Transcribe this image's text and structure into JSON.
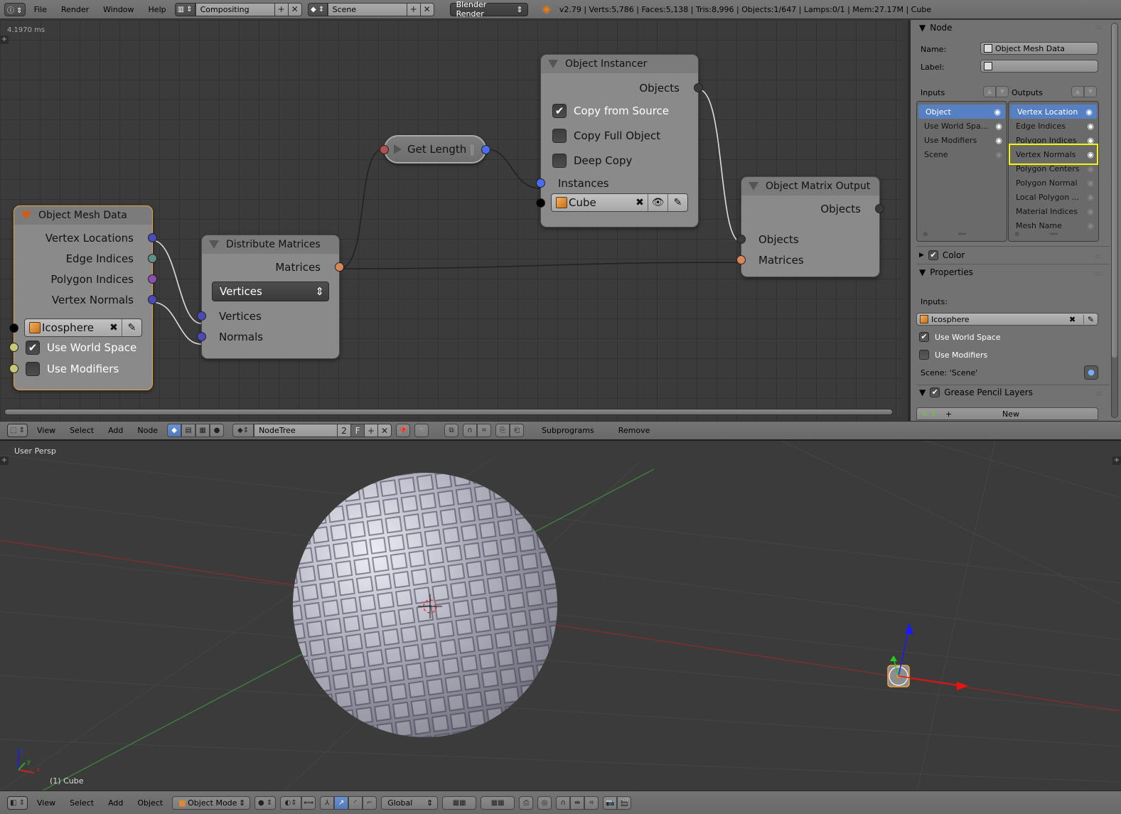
{
  "topbar": {
    "info_icon": "info-icon",
    "menus": [
      "File",
      "Render",
      "Window",
      "Help"
    ],
    "screen_layout": "Compositing",
    "scene": "Scene",
    "render_engine": "Blender Render",
    "stats": "v2.79 | Verts:5,786 | Faces:5,138 | Tris:8,996 | Objects:1/647 | Lamps:0/1 | Mem:27.17M | Cube"
  },
  "node_editor": {
    "timing": "4.1970 ms",
    "nodes": {
      "object_mesh_data": {
        "title": "Object Mesh Data",
        "outputs": [
          "Vertex Locations",
          "Edge Indices",
          "Polygon Indices",
          "Vertex Normals"
        ],
        "object": "Icosphere",
        "use_world_space": {
          "label": "Use World Space",
          "checked": true
        },
        "use_modifiers": {
          "label": "Use Modifiers",
          "checked": false
        }
      },
      "distribute_matrices": {
        "title": "Distribute Matrices",
        "output": "Matrices",
        "mode": "Vertices",
        "inputs": [
          "Vertices",
          "Normals"
        ]
      },
      "get_length": {
        "title": "Get Length"
      },
      "object_instancer": {
        "title": "Object Instancer",
        "output": "Objects",
        "copy_from_source": {
          "label": "Copy from Source",
          "checked": true
        },
        "copy_full_object": {
          "label": "Copy Full Object",
          "checked": false
        },
        "deep_copy": {
          "label": "Deep Copy",
          "checked": false
        },
        "input": "Instances",
        "object": "Cube"
      },
      "object_matrix_output": {
        "title": "Object Matrix Output",
        "output": "Objects",
        "inputs": [
          "Objects",
          "Matrices"
        ]
      }
    },
    "socket_colors": {
      "vector": "#4a4ab8",
      "edge_indices": "#5f8f86",
      "polygon_indices": "#8a50b0",
      "matrix": "#d9875a",
      "object": "#3a3a3a",
      "boolean": "#c8c878",
      "integer": "#4a6cf0",
      "list_input": "#b05050"
    }
  },
  "properties": {
    "node_panel_title": "Node",
    "name_label": "Name:",
    "name_value": "Object Mesh Data",
    "label_label": "Label:",
    "label_value": "",
    "inputs_title": "Inputs",
    "outputs_title": "Outputs",
    "inputs": [
      {
        "label": "Object",
        "visible": true,
        "selected": true
      },
      {
        "label": "Use World Spa...",
        "visible": true
      },
      {
        "label": "Use Modifiers",
        "visible": true
      },
      {
        "label": "Scene",
        "visible": false
      }
    ],
    "outputs": [
      {
        "label": "Vertex Location",
        "visible": true,
        "selected": true
      },
      {
        "label": "Edge Indices",
        "visible": true
      },
      {
        "label": "Polygon Indices",
        "visible": true
      },
      {
        "label": "Vertex Normals",
        "visible": true,
        "highlighted": true
      },
      {
        "label": "Polygon Centers",
        "visible": false
      },
      {
        "label": "Polygon Normal",
        "visible": false
      },
      {
        "label": "Local Polygon ...",
        "visible": false
      },
      {
        "label": "Material Indices",
        "visible": false
      },
      {
        "label": "Mesh Name",
        "visible": false
      }
    ],
    "color_panel": "Color",
    "properties_panel": "Properties",
    "inputs_sub": "Inputs:",
    "object": "Icosphere",
    "use_world_space": "Use World Space",
    "use_modifiers": "Use Modifiers",
    "scene": "Scene: 'Scene'",
    "grease_pencil": "Grease Pencil Layers",
    "new_button": "New"
  },
  "node_header": {
    "menus": [
      "View",
      "Select",
      "Add",
      "Node"
    ],
    "tree_name": "NodeTree",
    "users": "2",
    "fake_user": "F",
    "extra": [
      "Subprograms",
      "Remove"
    ]
  },
  "viewport": {
    "view_label": "User Persp",
    "object_label": "(1) Cube"
  },
  "viewport_header": {
    "menus": [
      "View",
      "Select",
      "Add",
      "Object"
    ],
    "mode": "Object Mode",
    "orientation": "Global"
  }
}
